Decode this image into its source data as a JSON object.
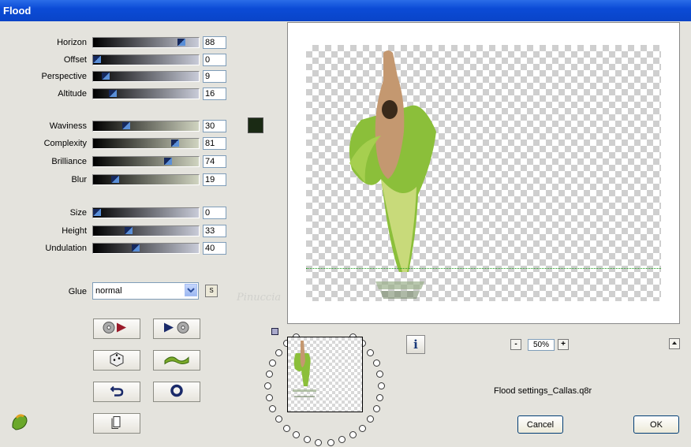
{
  "window": {
    "title": "Flood"
  },
  "sliders": [
    {
      "label": "Horizon",
      "value": "88",
      "frac": 0.88
    },
    {
      "label": "Offset",
      "value": "0",
      "frac": 0.0
    },
    {
      "label": "Perspective",
      "value": "9",
      "frac": 0.09
    },
    {
      "label": "Altitude",
      "value": "16",
      "frac": 0.16
    },
    {
      "label": "Waviness",
      "value": "30",
      "frac": 0.3
    },
    {
      "label": "Complexity",
      "value": "81",
      "frac": 0.81
    },
    {
      "label": "Brilliance",
      "value": "74",
      "frac": 0.74
    },
    {
      "label": "Blur",
      "value": "19",
      "frac": 0.19
    },
    {
      "label": "Size",
      "value": "0",
      "frac": 0.0
    },
    {
      "label": "Height",
      "value": "33",
      "frac": 0.33
    },
    {
      "label": "Undulation",
      "value": "40",
      "frac": 0.4
    }
  ],
  "glue": {
    "label": "Glue",
    "value": "normal",
    "s_button": "S"
  },
  "zoom": {
    "value": "50%",
    "minus": "-",
    "plus": "+"
  },
  "info_button": "i",
  "settings_file": "Flood settings_Callas.q8r",
  "buttons": {
    "cancel": "Cancel",
    "ok": "OK"
  },
  "watermark": "Pinuccia",
  "colors": {
    "water_color": "#1a2a14",
    "titlebar": "#0b4bd6"
  },
  "icons": [
    "presets-icon",
    "random-icon",
    "reset-icon",
    "copy-icon",
    "play-icon",
    "wave-icon",
    "circle-icon",
    "fu-logo-icon"
  ]
}
